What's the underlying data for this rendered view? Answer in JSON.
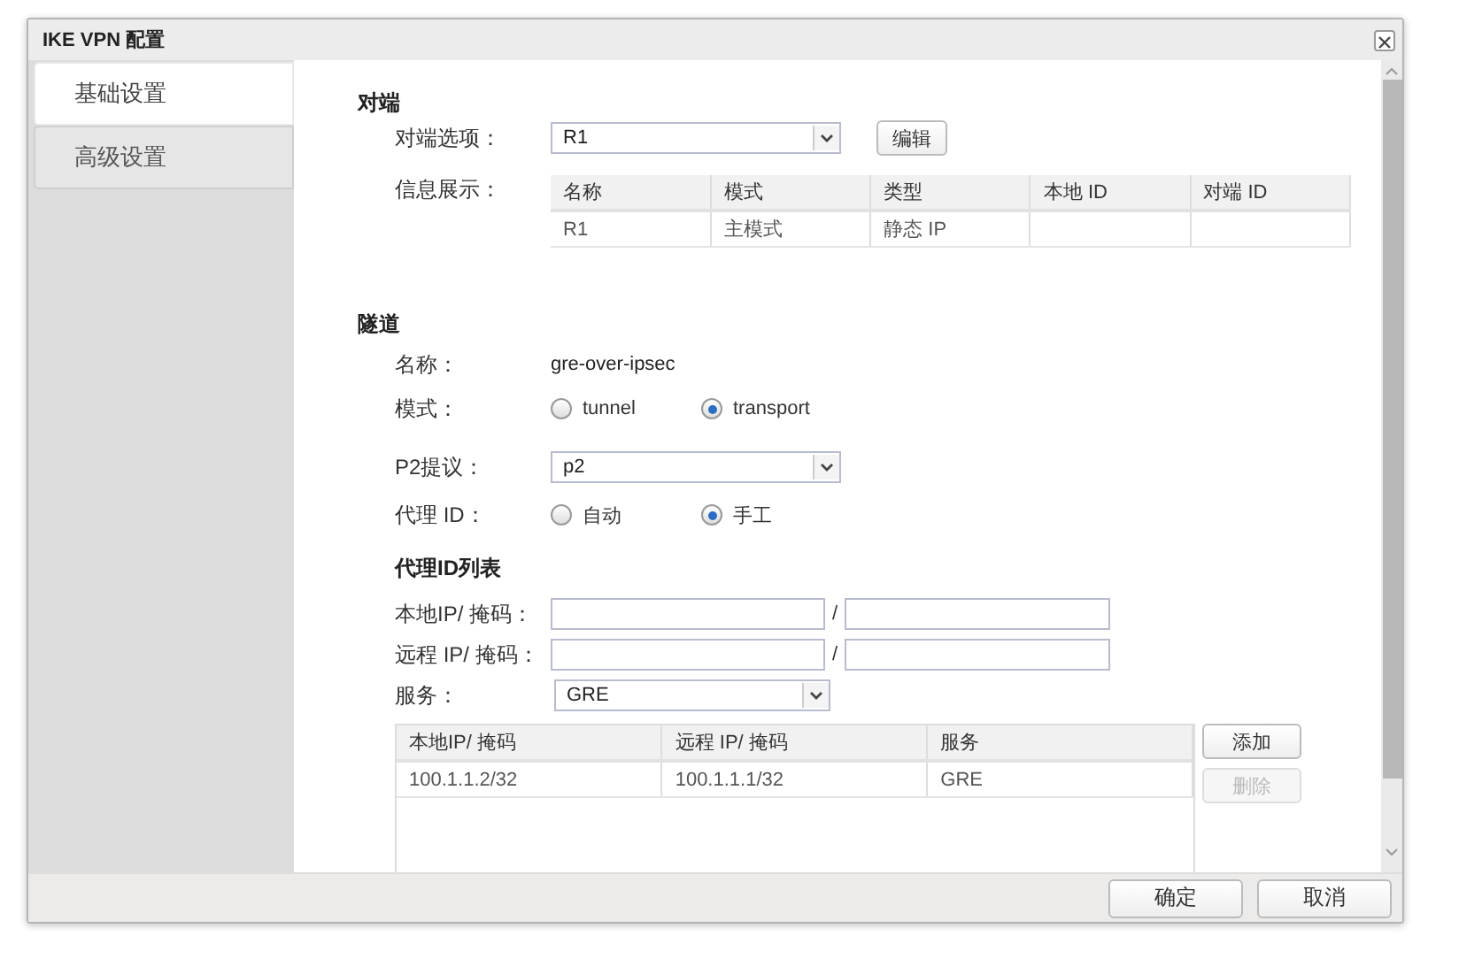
{
  "window": {
    "title": "IKE VPN 配置"
  },
  "sidebar": {
    "tabs": [
      {
        "label": "基础设置",
        "selected": true
      },
      {
        "label": "高级设置",
        "selected": false
      }
    ]
  },
  "peer": {
    "heading": "对端",
    "option_label": "对端选项：",
    "option_value": "R1",
    "edit_button": "编辑",
    "info_label": "信息展示：",
    "table": {
      "columns": [
        "名称",
        "模式",
        "类型",
        "本地 ID",
        "对端 ID"
      ],
      "rows": [
        [
          "R1",
          "主模式",
          "静态 IP"
        ]
      ]
    }
  },
  "tunnel": {
    "heading": "隧道",
    "name_label": "名称：",
    "name_value": "gre-over-ipsec",
    "mode_label": "模式：",
    "mode_options": [
      {
        "label": "tunnel",
        "selected": false
      },
      {
        "label": "transport",
        "selected": true
      }
    ],
    "p2_label": "P2提议：",
    "p2_value": "p2",
    "proxy_label": "代理 ID：",
    "proxy_options": [
      {
        "label": "自动",
        "selected": false
      },
      {
        "label": "手工",
        "selected": true
      }
    ]
  },
  "proxy_list": {
    "heading": "代理ID列表",
    "local_label": "本地IP/ 掩码：",
    "local_separator": "/",
    "remote_label": "远程 IP/ 掩码：",
    "remote_separator": "/",
    "service_label": "服务：",
    "service_value": "GRE",
    "table": {
      "columns": [
        "本地IP/ 掩码",
        "远程 IP/ 掩码",
        "服务"
      ],
      "rows": [
        [
          "100.1.1.2/32",
          "100.1.1.1/32",
          "GRE"
        ]
      ]
    },
    "buttons": [
      {
        "label": "添加",
        "disabled": false
      },
      {
        "label": "删除",
        "disabled": true
      }
    ]
  },
  "footer": {
    "buttons": [
      "确定",
      "取消"
    ]
  }
}
